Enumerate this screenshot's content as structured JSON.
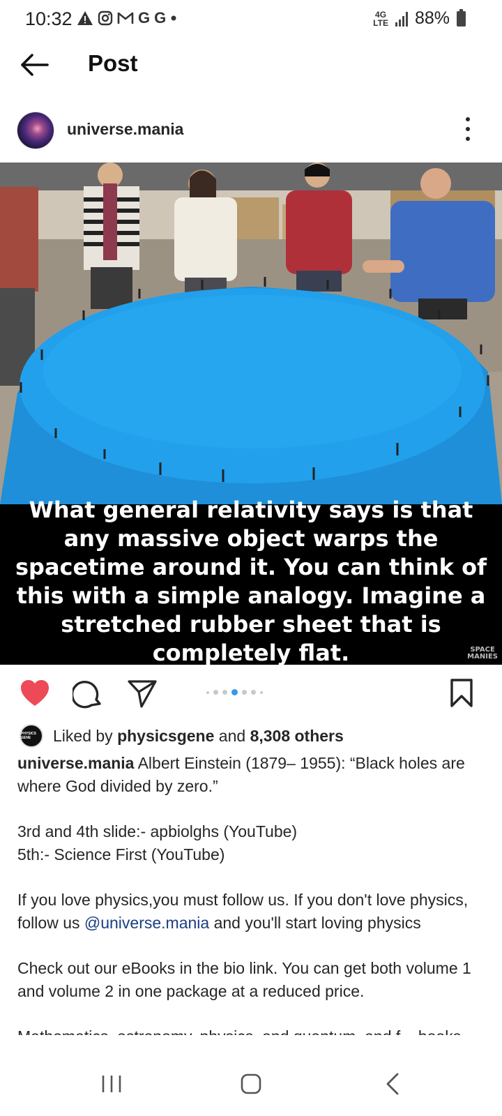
{
  "status_bar": {
    "time": "10:32",
    "notification_icons": [
      "warning-icon",
      "instagram-icon",
      "gmail-icon",
      "google-icon",
      "google-icon",
      "dot-icon"
    ],
    "network": "4G LTE",
    "battery": "88%"
  },
  "header": {
    "title": "Post"
  },
  "post": {
    "username": "universe.mania",
    "image_caption": "What general relativity says is that any massive object warps the spacetime around it. You can think of this with a simple analogy. Imagine a stretched rubber sheet that is completely flat.",
    "watermark": "SPACE MANIES",
    "carousel": {
      "total": 7,
      "active_index": 3
    },
    "likes": {
      "prefix": "Liked by ",
      "liker": "physicsgene",
      "middle": " and ",
      "others": "8,308 others",
      "liker_avatar_text": "PHYSICS GENE"
    },
    "caption": {
      "user": "universe.mania",
      "line1": " Albert Einstein (1879– 1955): “Black holes are where God divided by zero.”",
      "para2a": "3rd and 4th slide:- apbiolghs (YouTube)",
      "para2b": "5th:- Science First (YouTube)",
      "para3_pre": "If you love physics,you must follow us. If you don't love physics, follow us ",
      "para3_mention": "@universe.mania",
      "para3_post": " and you'll start loving physics",
      "para4": "Check out our eBooks in the bio link. You can get both volume 1 and volume 2 in one package at a reduced price.",
      "para5_partial": "Mathematics, astronomy, physics, and quantum, and f... books"
    }
  },
  "colors": {
    "like_red": "#ed4956",
    "mention_blue": "#1a3e84",
    "carousel_active": "#3897f0",
    "sheet_blue": "#1f9ee8"
  }
}
